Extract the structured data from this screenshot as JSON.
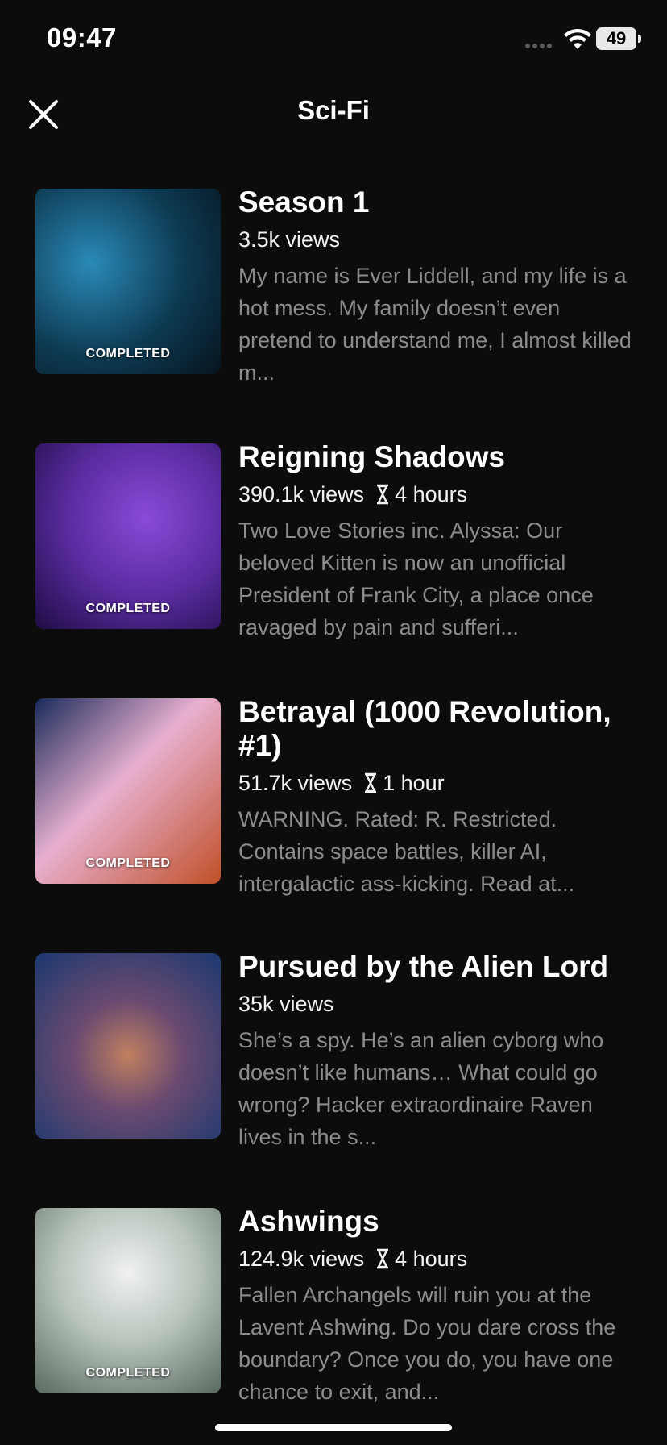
{
  "status_bar": {
    "time": "09:47",
    "battery": "49"
  },
  "header": {
    "title": "Sci-Fi",
    "close_icon": "close-icon"
  },
  "books": [
    {
      "title": "Season 1",
      "views": "3.5k views",
      "duration": "",
      "badge": "COMPLETED",
      "description": "My name is Ever Liddell, and my life is a hot mess. My family doesn’t even pretend to understand me, I almost killed m...",
      "cover_colors": [
        "#0d3a52",
        "#2a7fa8",
        "#0a1a2a"
      ]
    },
    {
      "title": "Reigning Shadows",
      "views": "390.1k views",
      "duration": "4 hours",
      "badge": "COMPLETED",
      "description": "Two Love Stories inc. Alyssa: Our beloved Kitten is now an unofficial President of Frank City, a place once ravaged by pain and sufferi...",
      "cover_colors": [
        "#5a2ca0",
        "#8a4ad8",
        "#2a1460"
      ]
    },
    {
      "title": "Betrayal (1000 Revolution, #1)",
      "views": "51.7k views",
      "duration": "1 hour",
      "badge": "COMPLETED",
      "description": "WARNING. Rated: R. Restricted. Contains space battles, killer AI, intergalactic ass-kicking. Read at...",
      "cover_colors": [
        "#1a2a5a",
        "#e8b0d0",
        "#b04020"
      ]
    },
    {
      "title": "Pursued by the Alien Lord",
      "views": "35k views",
      "duration": "",
      "badge": "",
      "description": "She’s a spy. He’s an alien cyborg who doesn’t like humans… What could go wrong? Hacker extraordinaire Raven lives in the s...",
      "cover_colors": [
        "#1a3870",
        "#c08060",
        "#203060"
      ]
    },
    {
      "title": "Ashwings",
      "views": "124.9k views",
      "duration": "4 hours",
      "badge": "COMPLETED",
      "description": "Fallen Archangels will ruin you at the Lavent Ashwing. Do you dare cross the boundary? Once you do, you have one chance to exit, and...",
      "cover_colors": [
        "#9aa8a0",
        "#e8ecea",
        "#5a6a60"
      ]
    }
  ]
}
